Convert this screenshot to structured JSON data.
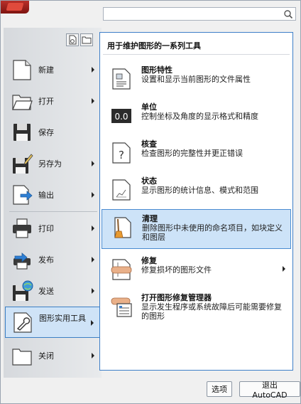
{
  "search": {
    "placeholder": ""
  },
  "left_menu": [
    {
      "key": "new",
      "label": "新建",
      "icon": "new-document-icon",
      "has_submenu": true
    },
    {
      "key": "open",
      "label": "打开",
      "icon": "folder-open-icon",
      "has_submenu": true
    },
    {
      "key": "save",
      "label": "保存",
      "icon": "floppy-disk-icon",
      "has_submenu": false
    },
    {
      "key": "save-as",
      "label": "另存为",
      "icon": "save-as-icon",
      "has_submenu": true
    },
    {
      "key": "export",
      "label": "输出",
      "icon": "export-icon",
      "has_submenu": true
    },
    {
      "key": "print",
      "label": "打印",
      "icon": "printer-icon",
      "has_submenu": true
    },
    {
      "key": "publish",
      "label": "发布",
      "icon": "publish-icon",
      "has_submenu": true
    },
    {
      "key": "send",
      "label": "发送",
      "icon": "send-icon",
      "has_submenu": true
    },
    {
      "key": "drawing-utilities",
      "label": "图形实用工具",
      "icon": "wrench-icon",
      "has_submenu": true,
      "active": true
    },
    {
      "key": "close",
      "label": "关闭",
      "icon": "folder-close-icon",
      "has_submenu": true
    }
  ],
  "flyout": {
    "title": "用于维护图形的一系列工具",
    "items": [
      {
        "key": "drawing-properties",
        "name": "图形特性",
        "desc": "设置和显示当前图形的文件属性",
        "icon": "properties-icon"
      },
      {
        "key": "units",
        "name": "单位",
        "desc": "控制坐标及角度的显示格式和精度",
        "icon": "units-icon",
        "icon_text": "0.0"
      },
      {
        "key": "audit",
        "name": "核查",
        "desc": "检查图形的完整性并更正错误",
        "icon": "audit-icon",
        "icon_text": "?"
      },
      {
        "key": "status",
        "name": "状态",
        "desc": "显示图形的统计信息、模式和范围",
        "icon": "status-icon"
      },
      {
        "key": "purge",
        "name": "清理",
        "desc": "删除图形中未使用的命名项目，如块定义和图层",
        "icon": "purge-broom-icon",
        "active": true
      },
      {
        "key": "recover",
        "name": "修复",
        "desc": "修复损坏的图形文件",
        "icon": "recover-icon",
        "has_submenu": true
      },
      {
        "key": "recovery-manager",
        "name": "打开图形修复管理器",
        "desc": "显示发生程序或系统故障后可能需要修复的图形",
        "icon": "recovery-manager-icon"
      }
    ]
  },
  "buttons": {
    "options": "选项",
    "exit": "退出 AutoCAD"
  },
  "colors": {
    "accent": "#3e7fc8",
    "highlight": "#cde3f8"
  }
}
